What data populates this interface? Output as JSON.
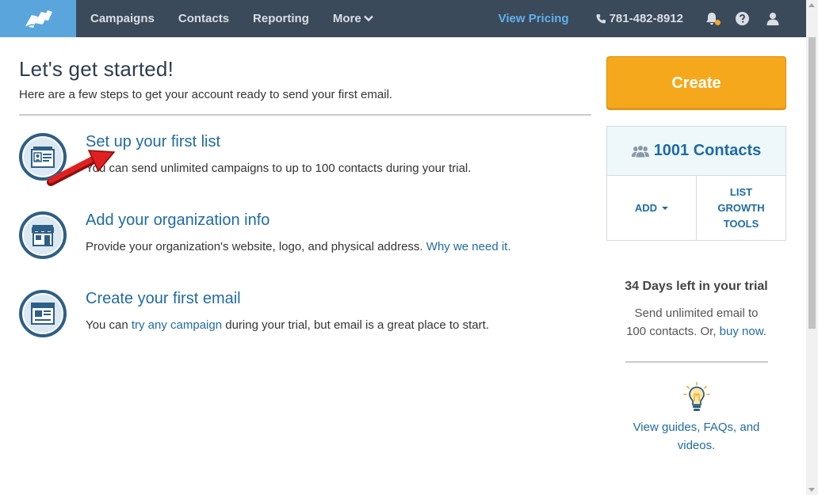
{
  "nav": {
    "items": [
      {
        "label": "Campaigns"
      },
      {
        "label": "Contacts"
      },
      {
        "label": "Reporting"
      },
      {
        "label": "More"
      }
    ],
    "view_pricing": "View Pricing",
    "phone": "781-482-8912"
  },
  "main": {
    "title": "Let's get started!",
    "subtitle": "Here are a few steps to get your account ready to send your first email.",
    "steps": [
      {
        "title": "Set up your first list",
        "desc": "You can send unlimited campaigns to up to 100 contacts during your trial."
      },
      {
        "title": "Add your organization info",
        "desc": "Provide your organization's website, logo, and physical address.",
        "link": "Why we need it."
      },
      {
        "title": "Create your first email",
        "desc_pre": "You can",
        "link": "try any campaign",
        "desc_post": "during your trial, but email is a great place to start."
      }
    ]
  },
  "sidebar": {
    "create_label": "Create",
    "contacts_count": "1001 Contacts",
    "add_label": "ADD",
    "list_growth_label": [
      "LIST",
      "GROWTH",
      "TOOLS"
    ],
    "trial_title": "34 Days left in your trial",
    "trial_desc": "Send unlimited email to 100 contacts. Or,",
    "buy_now": "buy now.",
    "guides": "View guides, FAQs, and videos."
  },
  "colors": {
    "nav_bg": "#3b4a5a",
    "logo_bg": "#5aa6dc",
    "link": "#1f6ba5",
    "create_btn": "#f6a81c",
    "annotation_arrow": "#e02020"
  }
}
